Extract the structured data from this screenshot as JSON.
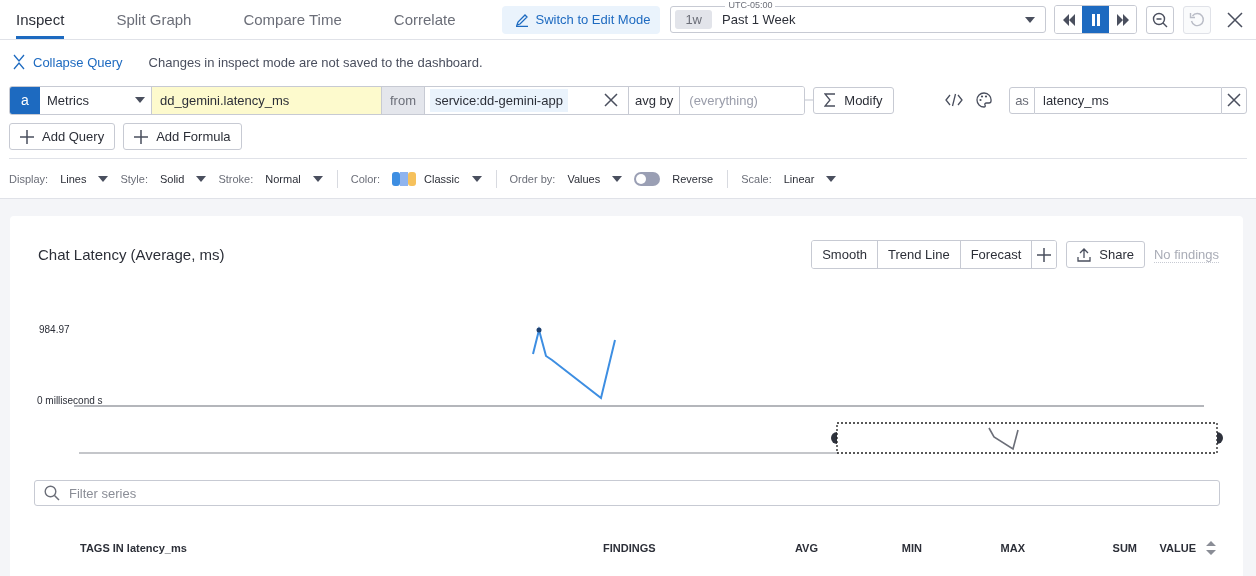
{
  "tabs": [
    {
      "label": "Inspect",
      "selected": true
    },
    {
      "label": "Split Graph",
      "selected": false
    },
    {
      "label": "Compare Time",
      "selected": false
    },
    {
      "label": "Correlate",
      "selected": false
    }
  ],
  "edit_mode_button": "Switch to Edit Mode",
  "time_picker": {
    "timezone": "UTC-05:00",
    "chip": "1w",
    "range": "Past 1 Week"
  },
  "playback": [
    {
      "kind": "rewind",
      "selected": false
    },
    {
      "kind": "pause",
      "selected": true
    },
    {
      "kind": "forward",
      "selected": false
    }
  ],
  "reset": {
    "disabled": true
  },
  "collapse_query": "Collapse Query",
  "notice": "Changes in inspect mode are not saved to the dashboard.",
  "query": {
    "letter": "a",
    "source": "Metrics",
    "metric": "dd_gemini.latency_ms",
    "from_label": "from",
    "filter_tag": "service:dd-gemini-app",
    "avg_by_label": "avg by",
    "group_placeholder": "(everything)",
    "modify": "Modify",
    "alias_label": "as",
    "alias": "latency_ms"
  },
  "add_buttons": [
    "Add Query",
    "Add Formula"
  ],
  "display_options": [
    {
      "kind": "dropdown",
      "label": "Display:",
      "value": "Lines"
    },
    {
      "kind": "dropdown",
      "label": "Style:",
      "value": "Solid"
    },
    {
      "kind": "dropdown",
      "label": "Stroke:",
      "value": "Normal"
    },
    {
      "kind": "palette",
      "label": "Color:",
      "value": "Classic"
    },
    {
      "kind": "dropdown",
      "label": "Order by:",
      "value": "Values"
    },
    {
      "kind": "toggle",
      "label": "Reverse",
      "on": false
    },
    {
      "kind": "dropdown",
      "label": "Scale:",
      "value": "Linear"
    }
  ],
  "card": {
    "title": "Chat Latency (Average, ms)",
    "actions": [
      "Smooth",
      "Trend Line",
      "Forecast"
    ],
    "share": "Share",
    "findings": "No findings",
    "chart": {
      "y_labels": [
        "984.97",
        "0 millisecond s"
      ]
    },
    "filter": {
      "placeholder": "Filter series"
    },
    "columns": [
      "TAGS IN latency_ms",
      "FINDINGS",
      "AVG",
      "MIN",
      "MAX",
      "SUM",
      "VALUE"
    ]
  }
}
